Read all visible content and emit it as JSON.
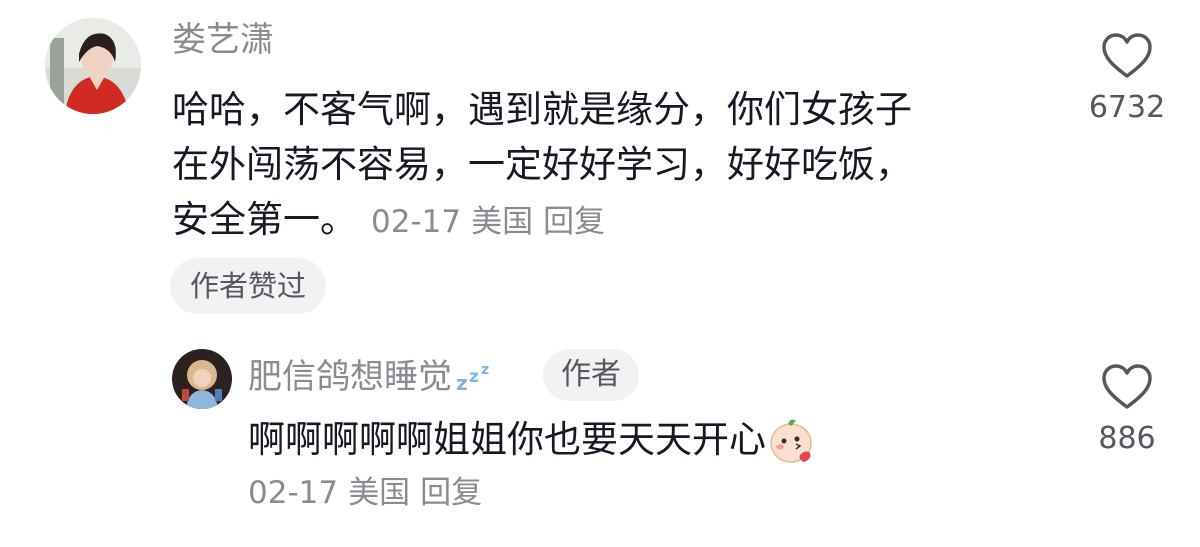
{
  "comments": [
    {
      "username": "娄艺潇",
      "text_lines": [
        "哈哈，不客气啊，遇到就是缘分，你们女孩子",
        "在外闯荡不容易，一定好好学习，好好吃饭，",
        "安全第一。"
      ],
      "date": "02-17",
      "location": "美国",
      "reply_label": "回复",
      "author_liked_badge": "作者赞过",
      "like_count": "6732",
      "avatar_icon": "avatar-woman-red-dress"
    }
  ],
  "reply": {
    "username": "肥信鸽想睡觉",
    "username_icon": "zzz-sleep-icon",
    "author_badge": "作者",
    "text": "啊啊啊啊啊姐姐你也要天天开心",
    "text_emoji": "blush-emoji",
    "date": "02-17",
    "location": "美国",
    "reply_label": "回复",
    "like_count": "886",
    "avatar_icon": "avatar-child"
  },
  "colors": {
    "text_primary": "#161823",
    "text_secondary": "#8a8b91",
    "badge_bg": "#f2f2f4",
    "heart_stroke": "#56575e"
  }
}
